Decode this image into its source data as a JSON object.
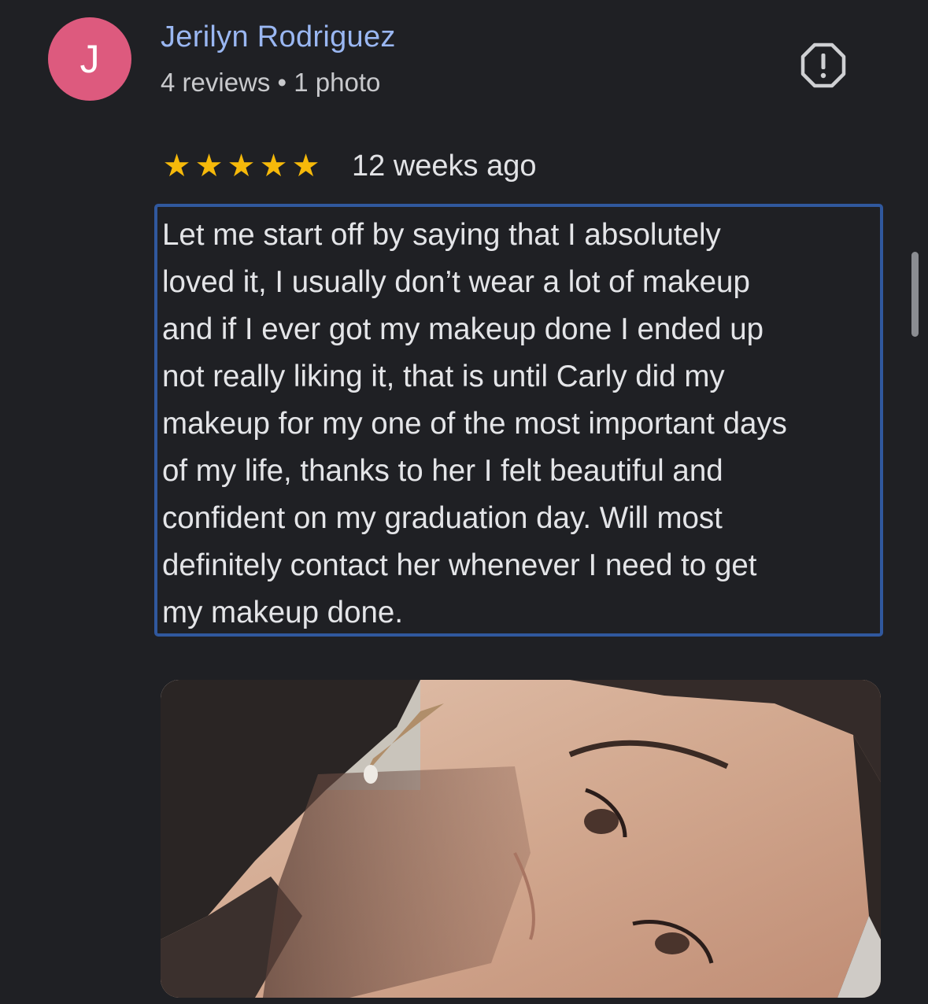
{
  "reviewer": {
    "initial": "J",
    "name": "Jerilyn Rodriguez",
    "meta": "4 reviews • 1 photo",
    "avatar_color": "#dd5a7e",
    "name_color": "#9ab7f2"
  },
  "actions": {
    "report_icon": "report-flag-icon"
  },
  "review": {
    "rating": 5,
    "max_rating": 5,
    "star_color": "#f6b90a",
    "date": "12 weeks ago",
    "text": "Let me start off by saying that I absolutely\nloved it, I usually don’t wear a lot of makeup\nand if I ever got my makeup done I ended up\nnot really liking it, that is until Carly did my\nmakeup for my one of the most important days\nof my life, thanks to her I felt beautiful and\nconfident on my graduation day. Will most\ndefinitely contact her whenever I need to get\nmy makeup done.",
    "highlight_color": "#30589e"
  },
  "photo": {
    "subject": "review-photo-selfie"
  },
  "theme": {
    "background": "#1f2024"
  }
}
